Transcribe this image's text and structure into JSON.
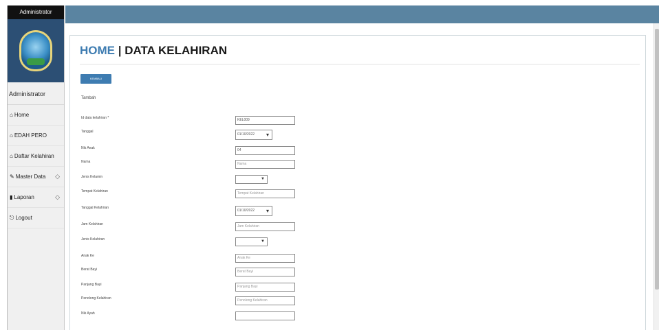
{
  "sidebar": {
    "app_title": "Administrator",
    "user_label": "Administrator",
    "items": [
      {
        "label": "Home",
        "icon": "home-icon",
        "glyph": "⌂",
        "chevron": ""
      },
      {
        "label": "EDAH PERO",
        "icon": "home-icon",
        "glyph": "⌂",
        "chevron": ""
      },
      {
        "label": "Daftar Kelahiran",
        "icon": "home-icon",
        "glyph": "⌂",
        "chevron": ""
      },
      {
        "label": "Master Data",
        "icon": "edit-icon",
        "glyph": "✎",
        "chevron": "◇"
      },
      {
        "label": "Laporan",
        "icon": "report-icon",
        "glyph": "▮",
        "chevron": "◇"
      },
      {
        "label": "Logout",
        "icon": "logout-icon",
        "glyph": "⎋",
        "chevron": ""
      }
    ]
  },
  "header": {
    "home": "HOME",
    "separator": "|",
    "title": "DATA KELAHIRAN"
  },
  "buttons": {
    "back": "KEMBALI"
  },
  "form": {
    "heading": "Tambah",
    "fields": [
      {
        "label": "Id data kelahiran *",
        "type": "text",
        "value": "KEL009"
      },
      {
        "label": "Tanggal",
        "type": "date",
        "value": "01/10/2022"
      },
      {
        "label": "Nik Anak",
        "type": "text",
        "value": "04"
      },
      {
        "label": "Nama",
        "type": "text",
        "value": "Nama"
      },
      {
        "label": "Jenis Kelamin",
        "type": "select",
        "value": ""
      },
      {
        "label": "Tempat Kelahiran",
        "type": "text",
        "value": "Tempat Kelahiran"
      },
      {
        "label": "Tanggal Kelahiran",
        "type": "date",
        "value": "01/10/2022"
      },
      {
        "label": "Jam Kelahiran",
        "type": "text",
        "value": "Jam Kelahiran"
      },
      {
        "label": "Jenis Kelahiran",
        "type": "select",
        "value": ""
      },
      {
        "label": "Anak Ke",
        "type": "text",
        "value": "Anak Ke"
      },
      {
        "label": "Berat Bayi",
        "type": "text",
        "value": "Berat Bayi"
      },
      {
        "label": "Panjang Bayi",
        "type": "text",
        "value": "Panjang Bayi"
      },
      {
        "label": "Penolong Kelahiran",
        "type": "text",
        "value": "Penolong Kelahiran"
      },
      {
        "label": "Nik Ayah",
        "type": "text",
        "value": ""
      }
    ]
  },
  "colors": {
    "topbar": "#5a84a1",
    "accent": "#3e7cb1",
    "sidebar_bg": "#f0f0f0"
  }
}
